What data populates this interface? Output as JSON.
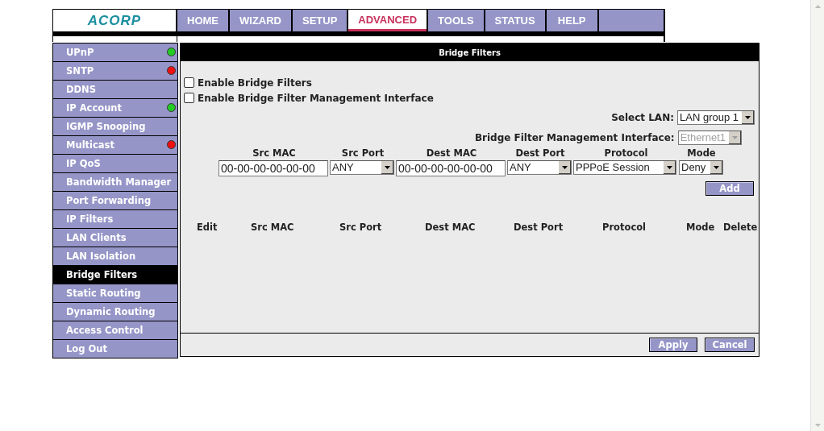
{
  "logo": "ACORP",
  "nav": [
    {
      "label": "HOME",
      "selected": false
    },
    {
      "label": "WIZARD",
      "selected": false
    },
    {
      "label": "SETUP",
      "selected": false
    },
    {
      "label": "ADVANCED",
      "selected": true
    },
    {
      "label": "TOOLS",
      "selected": false
    },
    {
      "label": "STATUS",
      "selected": false
    },
    {
      "label": "HELP",
      "selected": false
    }
  ],
  "sidebar": {
    "items": [
      {
        "label": "UPnP",
        "selected": false,
        "color": "#22cc22"
      },
      {
        "label": "SNTP",
        "selected": false,
        "color": "#ee1111"
      },
      {
        "label": "DDNS",
        "selected": false
      },
      {
        "label": "IP Account",
        "selected": false,
        "color": "#22cc22"
      },
      {
        "label": "IGMP Snooping",
        "selected": false
      },
      {
        "label": "Multicast",
        "selected": false,
        "color": "#ee1111"
      },
      {
        "label": "IP QoS",
        "selected": false
      },
      {
        "label": "Bandwidth Manager",
        "selected": false
      },
      {
        "label": "Port Forwarding",
        "selected": false
      },
      {
        "label": "IP Filters",
        "selected": false
      },
      {
        "label": "LAN Clients",
        "selected": false
      },
      {
        "label": "LAN Isolation",
        "selected": false
      },
      {
        "label": "Bridge Filters",
        "selected": true
      },
      {
        "label": "Static Routing",
        "selected": false
      },
      {
        "label": "Dynamic Routing",
        "selected": false
      },
      {
        "label": "Access Control",
        "selected": false
      },
      {
        "label": "Log Out",
        "selected": false
      }
    ]
  },
  "panel": {
    "title": "Bridge Filters",
    "checkboxes": [
      {
        "label": "Enable Bridge Filters",
        "checked": false
      },
      {
        "label": "Enable Bridge Filter Management Interface",
        "checked": false
      }
    ],
    "select_lan": {
      "label": "Select LAN:",
      "value": "LAN group 1",
      "disabled": false
    },
    "management_interface": {
      "label": "Bridge Filter Management Interface:",
      "value": "Ethernet1",
      "disabled": true
    },
    "form_columns": [
      "Src MAC",
      "Src Port",
      "Dest MAC",
      "Dest Port",
      "Protocol",
      "Mode"
    ],
    "form_fields": [
      {
        "kind": "text",
        "value": "00-00-00-00-00-00"
      },
      {
        "kind": "select",
        "value": "ANY"
      },
      {
        "kind": "text",
        "value": "00-00-00-00-00-00"
      },
      {
        "kind": "select",
        "value": "ANY"
      },
      {
        "kind": "select",
        "value": "PPPoE Session"
      },
      {
        "kind": "select",
        "value": "Deny"
      }
    ],
    "add_button": "Add",
    "table": {
      "columns": [
        "Edit",
        "Src MAC",
        "Src Port",
        "Dest MAC",
        "Dest Port",
        "Protocol",
        "Mode",
        "Delete"
      ]
    },
    "buttons": [
      "Apply",
      "Cancel"
    ]
  }
}
